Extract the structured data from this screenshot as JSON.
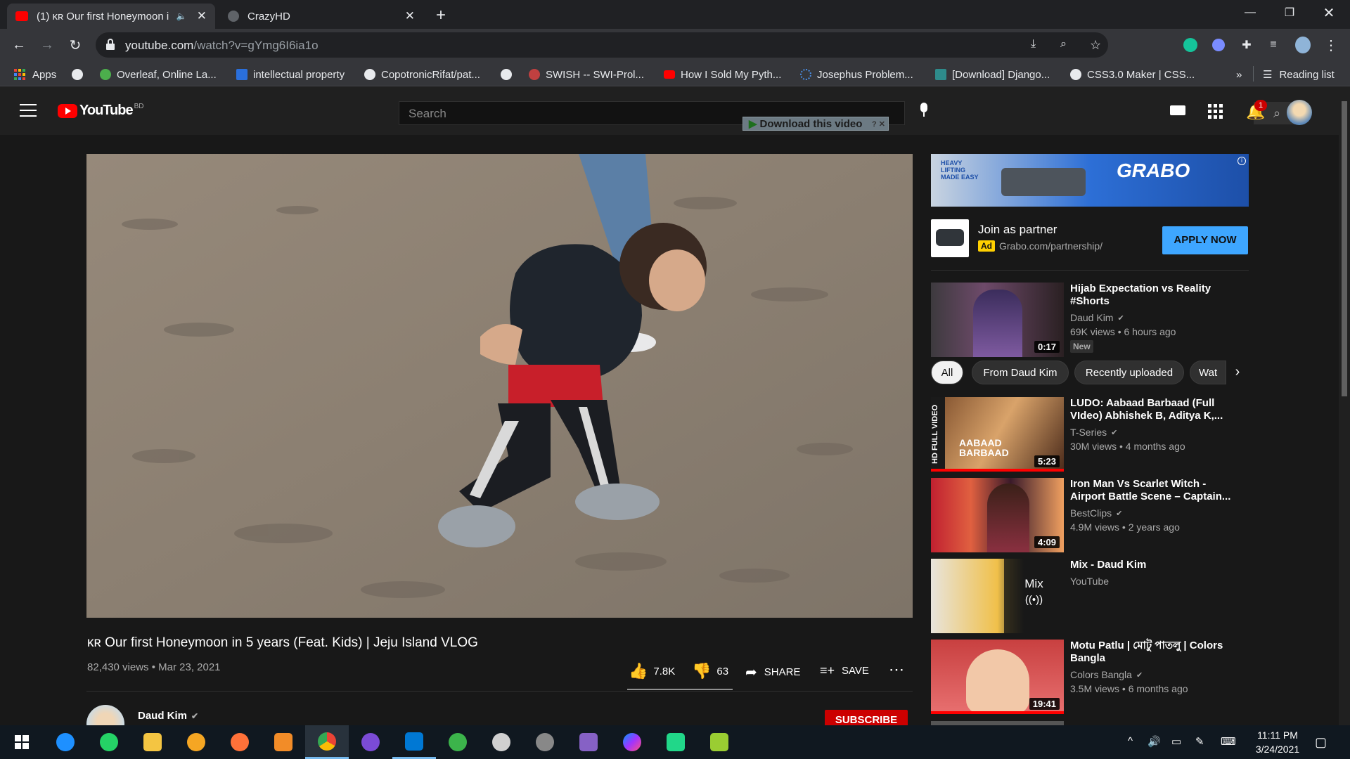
{
  "tabs": [
    {
      "label": "(1) ᴋʀ Our first Honeymoon i",
      "active": true
    },
    {
      "label": "CrazyHD",
      "active": false
    }
  ],
  "address": {
    "host": "youtube.com",
    "path": "/watch?v=gYmg6I6ia1o"
  },
  "bookmarks": [
    "Apps",
    "",
    "Overleaf, Online La...",
    "intellectual property",
    "CopotronicRifat/pat...",
    "",
    "SWISH -- SWI-Prol...",
    "How I Sold My Pyth...",
    "Josephus Problem...",
    "[Download] Django...",
    "CSS3.0 Maker | CSS...",
    "»",
    "Reading list"
  ],
  "youtube": {
    "logo": "YouTube",
    "country": "BD",
    "search_placeholder": "Search",
    "download_label": "Download this video",
    "notifications": "1"
  },
  "video": {
    "title": "ᴋʀ Our first Honeymoon in 5 years (Feat. Kids) | Jeju Island VLOG",
    "meta": "82,430 views • Mar 23, 2021",
    "likes": "7.8K",
    "dislikes": "63",
    "share": "SHARE",
    "save": "SAVE",
    "channel": "Daud Kim",
    "subscribe": "SUBSCRIBE"
  },
  "ad": {
    "title": "Join as partner",
    "badge": "Ad",
    "url": "Grabo.com/partnership/",
    "cta": "APPLY NOW",
    "banner_text": "GRABO",
    "banner_tag": "HEAVY LIFTING MADE EASY"
  },
  "chips": [
    "All",
    "From Daud Kim",
    "Recently uploaded",
    "Wat"
  ],
  "related": [
    {
      "title": "Hijab Expectation vs Reality #Shorts",
      "channel": "Daud Kim",
      "meta": "69K views • 6 hours ago",
      "badge": "New",
      "duration": "0:17"
    },
    {
      "title": "LUDO: Aabaad Barbaad (Full VIdeo) Abhishek B, Aditya K,...",
      "channel": "T-Series",
      "meta": "30M views • 4 months ago",
      "duration": "5:23",
      "thumb_text": "AABAAD BARBAAD",
      "side_text": "HD FULL VIDEO"
    },
    {
      "title": "Iron Man Vs Scarlet Witch - Airport Battle Scene – Captain...",
      "channel": "BestClips",
      "meta": "4.9M views • 2 years ago",
      "duration": "4:09"
    },
    {
      "title": "Mix - Daud Kim",
      "channel": "YouTube",
      "meta": "",
      "duration": "Mix"
    },
    {
      "title": "Motu Patlu | মোটু পাতলু | Colors Bangla",
      "channel": "Colors Bangla",
      "meta": "3.5M views • 6 months ago",
      "duration": "19:41"
    }
  ],
  "taskbar": {
    "time": "11:11 PM",
    "date": "3/24/2021"
  },
  "colors": {
    "yt_red": "#ff0000",
    "accent_blue": "#3ea6ff",
    "chrome_dark": "#202124",
    "chrome_tab": "#35363a"
  }
}
